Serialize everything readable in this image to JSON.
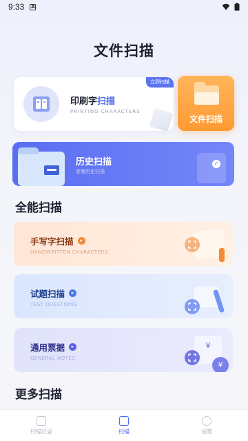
{
  "status_bar": {
    "time": "9:33",
    "notif": "A"
  },
  "page": {
    "title": "文件扫描"
  },
  "print_card": {
    "badge": "立即扫描",
    "title_prefix": "印刷字",
    "title_highlight": "扫描",
    "subtitle": "PRINTING CHARACTERS"
  },
  "file_card": {
    "label": "文件扫描"
  },
  "history_card": {
    "title": "历史扫描",
    "subtitle": "查看历史扫描"
  },
  "sections": {
    "all": "全能扫描",
    "more": "更多扫描"
  },
  "features": {
    "handwritten": {
      "title": "手写字扫描",
      "subtitle": "HANDWRITTEN CHARACTERS"
    },
    "test": {
      "title": "试题扫描",
      "subtitle": "TEST QUESTIONS"
    },
    "bill": {
      "title": "通用票据",
      "subtitle": "GENERAL NOTES",
      "symbol": "¥"
    }
  },
  "bottom_nav": {
    "items": [
      {
        "label": "扫描记录"
      },
      {
        "label": "扫描"
      },
      {
        "label": "设置"
      }
    ]
  },
  "colors": {
    "accent": "#4f67ee",
    "orange": "#ff9a33"
  }
}
